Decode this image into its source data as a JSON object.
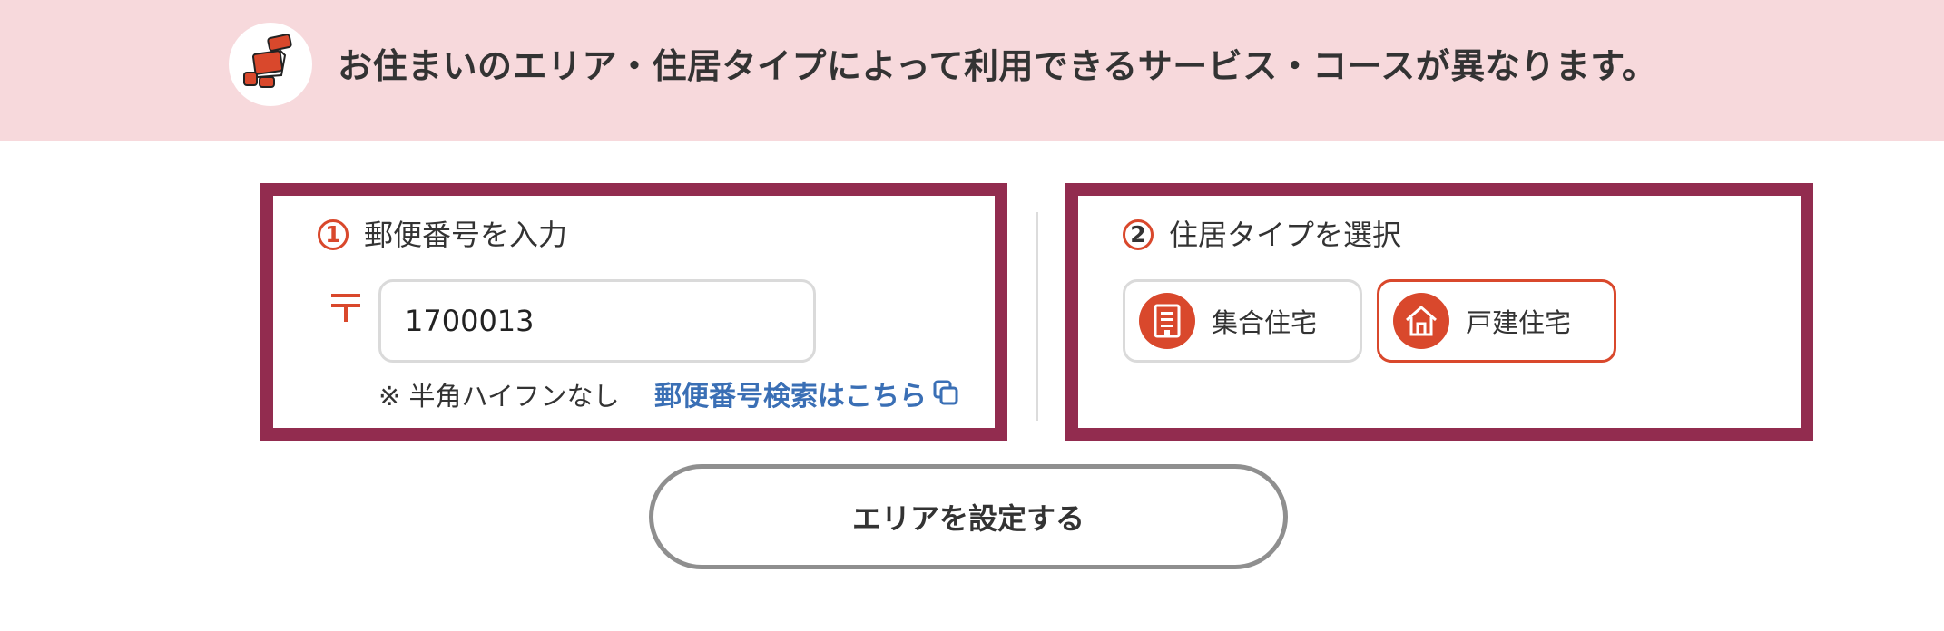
{
  "banner": {
    "message": "お住まいのエリア・住居タイプによって利用できるサービス・コースが異なります。",
    "icon": "moving-truck-icon"
  },
  "step1": {
    "number": "1",
    "label": "郵便番号を入力",
    "postal_mark": "〒",
    "zip_value": "1700013",
    "note": "※ 半角ハイフンなし",
    "search_link": "郵便番号検索はこちら",
    "link_icon": "external-window-icon"
  },
  "step2": {
    "number": "2",
    "label": "住居タイプを選択",
    "options": [
      {
        "label": "集合住宅",
        "icon": "apartment-icon",
        "selected": false
      },
      {
        "label": "戸建住宅",
        "icon": "house-icon",
        "selected": true
      }
    ]
  },
  "action": {
    "set_area": "エリアを設定する"
  },
  "colors": {
    "banner_bg": "#f7d9dc",
    "panel_border": "#922c4f",
    "accent": "#d9482c",
    "link": "#3a6fb5"
  }
}
